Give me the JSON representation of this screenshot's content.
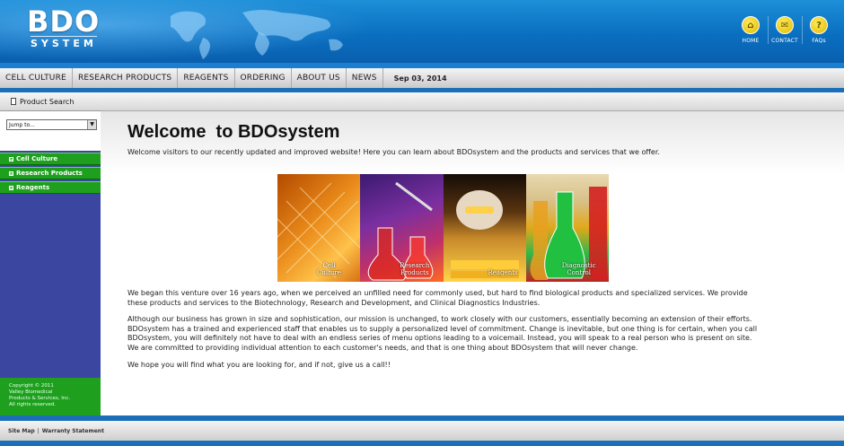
{
  "header": {
    "logo_main": "BDO",
    "logo_sub": "SYSTEM",
    "icons": [
      {
        "name": "home-icon",
        "label": "HOME",
        "glyph": "⌂"
      },
      {
        "name": "contact-icon",
        "label": "CONTACT",
        "glyph": "✉"
      },
      {
        "name": "faq-icon",
        "label": "FAQs",
        "glyph": "?"
      }
    ]
  },
  "nav": {
    "items": [
      "CELL CULTURE",
      "RESEARCH PRODUCTS",
      "REAGENTS",
      "ORDERING",
      "ABOUT US",
      "NEWS"
    ],
    "date": "Sep 03, 2014"
  },
  "sidebar": {
    "product_search": "Product Search",
    "jump_value": "Jump to...",
    "menu": [
      "Cell Culture",
      "Research Products",
      "Reagents"
    ],
    "copyright": [
      "Copyright © 2011",
      "Valley Biomedical",
      "Products & Services, Inc.",
      "All rights reserved."
    ]
  },
  "main": {
    "title": "Welcome  to BDOsystem",
    "intro": "Welcome visitors to our recently updated and improved website! Here you can learn about BDOsystem and the products and services that we offer.",
    "collage": [
      {
        "label_lines": [
          "Cell",
          "Culture"
        ]
      },
      {
        "label_lines": [
          "Research",
          "Products"
        ]
      },
      {
        "label_lines": [
          "Reagents"
        ]
      },
      {
        "label_lines": [
          "Diagnostic",
          "Control"
        ]
      }
    ],
    "para1": "We began this venture over 16 years ago, when we perceived an unfilled need for commonly used, but hard to find biological products and specialized services. We provide these products and services to the Biotechnology, Research and Development, and Clinical Diagnostics Industries.",
    "para2": "Although our business has grown in size and sophistication, our mission is unchanged, to work closely with our customers, essentially becoming an extension of their efforts. BDOsystem has a trained and experienced staff that enables us to supply a personalized level of commitment.  Change is inevitable, but one thing is for certain, when you call BDOsystem, you will definitely not have to deal with an endless series of menu options leading to a voicemail. Instead, you will speak to a real person who is present on site. We are committed to providing individual attention to each customer's needs, and that is one thing about BDOsystem that will never change.",
    "para3": "We hope you will find what you are looking for, and if not, give us a call!!"
  },
  "footer": {
    "links": [
      "Site Map",
      "Warranty Statement"
    ],
    "separator": "|"
  }
}
